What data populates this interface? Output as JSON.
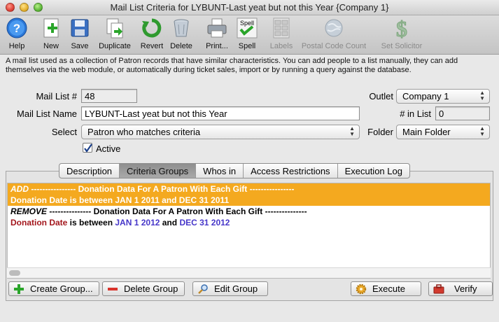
{
  "window": {
    "title": "Mail List Criteria for LYBUNT-Last yeat but not this Year {Company 1}"
  },
  "toolbar": {
    "items": [
      {
        "label": "Help",
        "icon": "help-icon",
        "enabled": true
      },
      {
        "label": "New",
        "icon": "new-icon",
        "enabled": true
      },
      {
        "label": "Save",
        "icon": "save-icon",
        "enabled": true
      },
      {
        "label": "Duplicate",
        "icon": "duplicate-icon",
        "enabled": true
      },
      {
        "label": "Revert",
        "icon": "revert-icon",
        "enabled": true
      },
      {
        "label": "Delete",
        "icon": "delete-icon",
        "enabled": true
      },
      {
        "label": "Print...",
        "icon": "print-icon",
        "enabled": true
      },
      {
        "label": "Spell",
        "icon": "spell-icon",
        "enabled": true,
        "icon_text": "Spell"
      },
      {
        "label": "Labels",
        "icon": "labels-icon",
        "enabled": false
      },
      {
        "label": "Postal Code Count",
        "icon": "globe-icon",
        "enabled": false
      },
      {
        "label": "Set Solicitor",
        "icon": "dollar-icon",
        "enabled": false
      }
    ]
  },
  "description": "A mail list used as a collection of Patron records that have similar characteristics.  You can add people to a list manually, they can add themselves via the web module, or automatically during ticket sales, import or by running a query against the database.",
  "form": {
    "mail_list_num_label": "Mail List #",
    "mail_list_num": "48",
    "outlet_label": "Outlet",
    "outlet": "Company 1",
    "name_label": "Mail List Name",
    "name": "LYBUNT-Last yeat but not this Year",
    "in_list_label": "# in List",
    "in_list": "0",
    "select_label": "Select",
    "select": "Patron who matches criteria",
    "folder_label": "Folder",
    "folder": "Main Folder",
    "active_label": "Active",
    "active": true
  },
  "tabs": [
    {
      "label": "Description",
      "active": false
    },
    {
      "label": "Criteria Groups",
      "active": true
    },
    {
      "label": "Whos in",
      "active": false
    },
    {
      "label": "Access Restrictions",
      "active": false
    },
    {
      "label": "Execution Log",
      "active": false
    }
  ],
  "criteria": [
    {
      "action": "ADD",
      "header_text": " ---------------- Donation Data For A Patron With Each Gift ----------------",
      "field": "Donation Date",
      "between": " is between ",
      "from": "JAN 1 2011",
      "and": " and ",
      "to": "DEC 31 2011",
      "selected": true
    },
    {
      "action": "REMOVE",
      "header_text": " --------------- Donation Data For A Patron With Each Gift ---------------",
      "field": "Donation Date",
      "between": " is between ",
      "from": "JAN 1 2012",
      "and": " and ",
      "to": "DEC 31 2012",
      "selected": false
    }
  ],
  "buttons": {
    "create_group": "Create Group...",
    "delete_group": "Delete Group",
    "edit_group": "Edit Group",
    "execute": "Execute",
    "verify": "Verify"
  },
  "colors": {
    "selection": "#f4a91f",
    "field_name": "#a3161c",
    "date_value": "#4636c9"
  }
}
